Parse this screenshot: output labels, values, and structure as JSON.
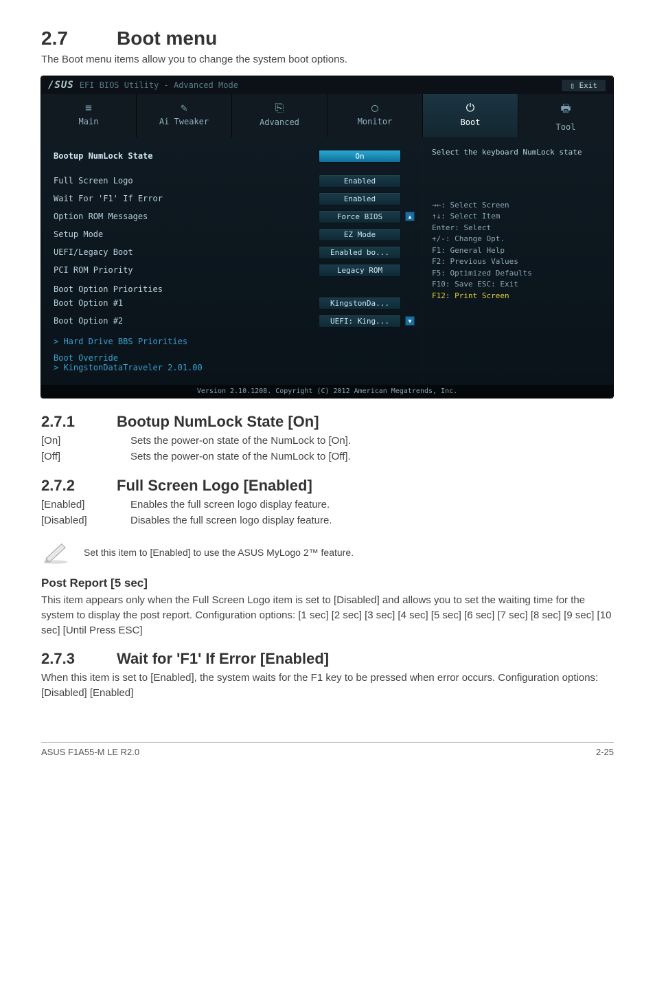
{
  "section": {
    "num": "2.7",
    "title": "Boot menu",
    "lead": "The Boot menu items allow you to change the system boot options."
  },
  "bios": {
    "brand": "/SUS",
    "subtitle": "EFI BIOS Utility - Advanced Mode",
    "exit": "Exit",
    "tabs": [
      {
        "label": "Main"
      },
      {
        "label": "Ai Tweaker"
      },
      {
        "label": "Advanced"
      },
      {
        "label": "Monitor"
      },
      {
        "label": "Boot"
      },
      {
        "label": "Tool"
      }
    ],
    "rows": {
      "numlock": {
        "label": "Bootup NumLock State",
        "value": "On"
      },
      "logo": {
        "label": "Full Screen Logo",
        "value": "Enabled"
      },
      "f1": {
        "label": "Wait For 'F1' If Error",
        "value": "Enabled"
      },
      "oprom": {
        "label": "Option ROM Messages",
        "value": "Force BIOS"
      },
      "setup": {
        "label": "Setup Mode",
        "value": "EZ Mode"
      },
      "uefi": {
        "label": "UEFI/Legacy Boot",
        "value": "Enabled bo..."
      },
      "pcirom": {
        "label": "PCI ROM Priority",
        "value": "Legacy ROM"
      }
    },
    "priorities": {
      "header": "Boot Option Priorities",
      "opt1": {
        "label": "Boot Option #1",
        "value": "KingstonDa..."
      },
      "opt2": {
        "label": "Boot Option #2",
        "value": "UEFI: King..."
      }
    },
    "hdd_link": "> Hard Drive BBS Priorities",
    "override_title": "Boot Override",
    "override_item": "> KingstonDataTraveler 2.01.00",
    "help_title": "Select the keyboard NumLock state",
    "help_lines": [
      "→←: Select Screen",
      "↑↓: Select Item",
      "Enter: Select",
      "+/-: Change Opt.",
      "F1: General Help",
      "F2: Previous Values",
      "F5: Optimized Defaults",
      "F10: Save   ESC: Exit"
    ],
    "help_yellow": "F12: Print Screen",
    "footer": "Version 2.10.1208. Copyright (C) 2012 American Megatrends, Inc."
  },
  "s271": {
    "num": "2.7.1",
    "title": "Bootup NumLock State [On]",
    "on": {
      "k": "[On]",
      "v": "Sets the power-on state of the NumLock to [On]."
    },
    "off": {
      "k": "[Off]",
      "v": "Sets the power-on state of the NumLock to [Off]."
    }
  },
  "s272": {
    "num": "2.7.2",
    "title": "Full Screen Logo [Enabled]",
    "en": {
      "k": "[Enabled]",
      "v": "Enables the full screen logo display feature."
    },
    "dis": {
      "k": "[Disabled]",
      "v": "Disables the full screen logo display feature."
    },
    "note": "Set this item to [Enabled] to use the ASUS MyLogo 2™ feature."
  },
  "post": {
    "title": "Post Report [5 sec]",
    "body": "This item appears only when the Full Screen Logo item is set to [Disabled] and allows you to set the waiting time for the system to display the post report. Configuration options: [1 sec] [2 sec] [3 sec] [4 sec] [5 sec] [6 sec] [7 sec] [8 sec] [9 sec] [10 sec] [Until Press ESC]"
  },
  "s273": {
    "num": "2.7.3",
    "title": "Wait for 'F1' If Error [Enabled]",
    "body": "When this item is set to [Enabled], the system waits for the F1 key to be pressed when error occurs. Configuration options: [Disabled] [Enabled]"
  },
  "footer": {
    "left": "ASUS F1A55-M LE R2.0",
    "right": "2-25"
  }
}
